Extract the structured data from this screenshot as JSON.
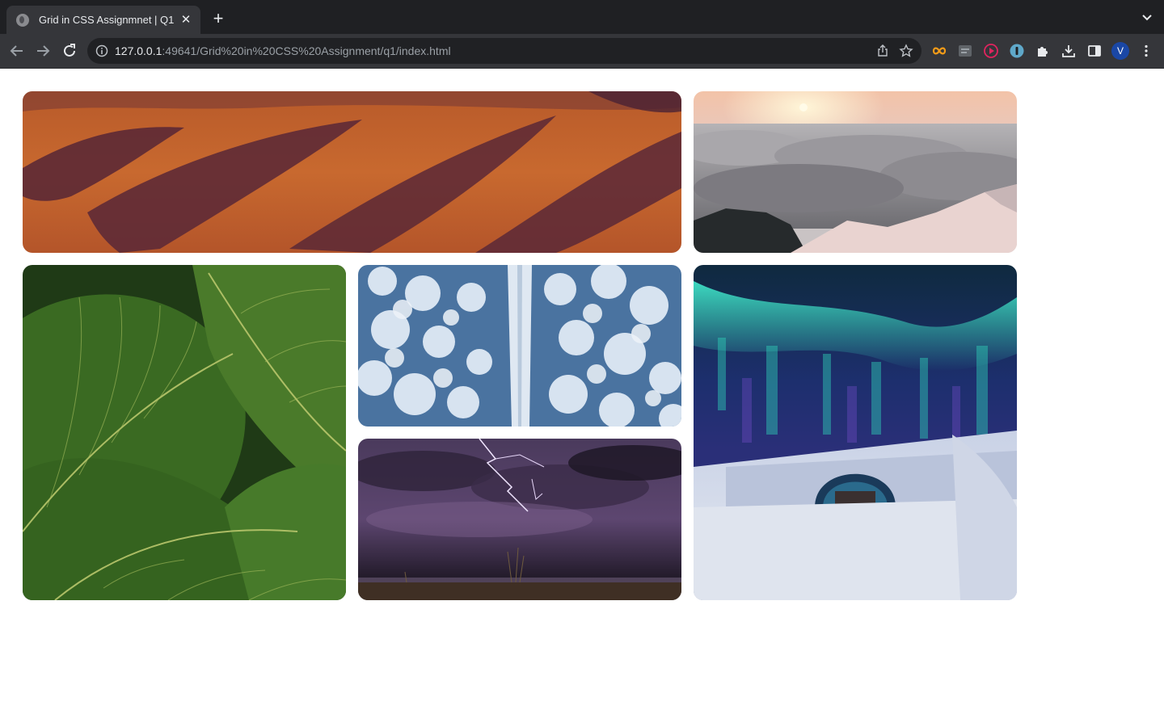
{
  "browser": {
    "tab_title": "Grid in CSS Assignmnet | Q1",
    "url_host": "127.0.0.1",
    "url_rest": ":49641/Grid%20in%20CSS%20Assignment/q1/index.html",
    "avatar_letter": "V",
    "icons": [
      "back-icon",
      "forward-icon",
      "reload-icon",
      "info-icon",
      "share-icon",
      "star-icon",
      "extension-infinity-icon",
      "extension-zip-icon",
      "extension-play-icon",
      "extension-lock-icon",
      "puzzle-icon",
      "download-icon",
      "side-panel-icon",
      "more-icon"
    ]
  },
  "gallery": {
    "images": [
      {
        "name": "desert-dunes",
        "palette": [
          "#c4622c",
          "#a94a24",
          "#5e2a32"
        ]
      },
      {
        "name": "sunrise-above-clouds",
        "palette": [
          "#f1c6a8",
          "#8c8b8e",
          "#e8c8c2"
        ]
      },
      {
        "name": "green-leaves",
        "palette": [
          "#2f5a1f",
          "#5d8a2c",
          "#b7c76a"
        ]
      },
      {
        "name": "snowy-forest-road",
        "palette": [
          "#3e6a96",
          "#b9cde4",
          "#e9eff6"
        ]
      },
      {
        "name": "lightning-storm",
        "palette": [
          "#3a2a4a",
          "#6a4f7a",
          "#1a1620"
        ]
      },
      {
        "name": "aurora-ice-hotel",
        "palette": [
          "#15254f",
          "#2fd0b8",
          "#dfe4ef"
        ]
      }
    ]
  }
}
